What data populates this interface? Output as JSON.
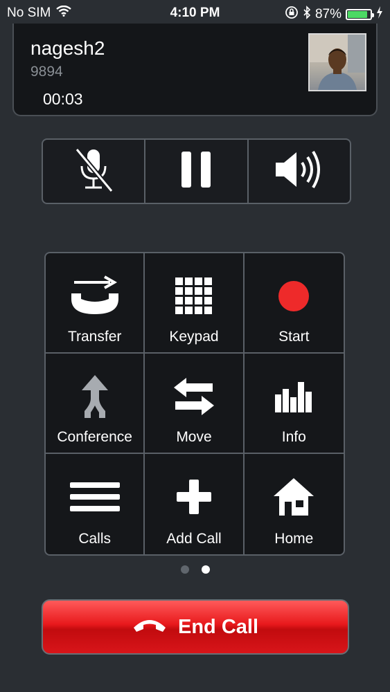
{
  "status_bar": {
    "carrier": "No SIM",
    "time": "4:10 PM",
    "battery_percent": "87%",
    "battery_level": 0.87,
    "battery_color": "#4cd964",
    "icons": [
      "wifi-icon",
      "orientation-lock-icon",
      "bluetooth-icon",
      "battery-icon",
      "charging-bolt-icon"
    ]
  },
  "caller": {
    "name": "nagesh2",
    "number": "9894",
    "duration": "00:03"
  },
  "controls": [
    {
      "name": "mute",
      "icon": "microphone-muted-icon"
    },
    {
      "name": "hold",
      "icon": "pause-icon"
    },
    {
      "name": "speaker",
      "icon": "speaker-icon"
    }
  ],
  "grid": [
    {
      "label": "Transfer",
      "icon": "transfer-icon"
    },
    {
      "label": "Keypad",
      "icon": "keypad-icon"
    },
    {
      "label": "Start",
      "icon": "record-icon"
    },
    {
      "label": "Conference",
      "icon": "conference-icon"
    },
    {
      "label": "Move",
      "icon": "move-icon"
    },
    {
      "label": "Info",
      "icon": "info-bars-icon"
    },
    {
      "label": "Calls",
      "icon": "calls-list-icon"
    },
    {
      "label": "Add Call",
      "icon": "add-call-icon"
    },
    {
      "label": "Home",
      "icon": "home-icon"
    }
  ],
  "pager": {
    "pages": 2,
    "current": 2
  },
  "end_call": {
    "label": "End Call",
    "color": "#e8191c"
  }
}
